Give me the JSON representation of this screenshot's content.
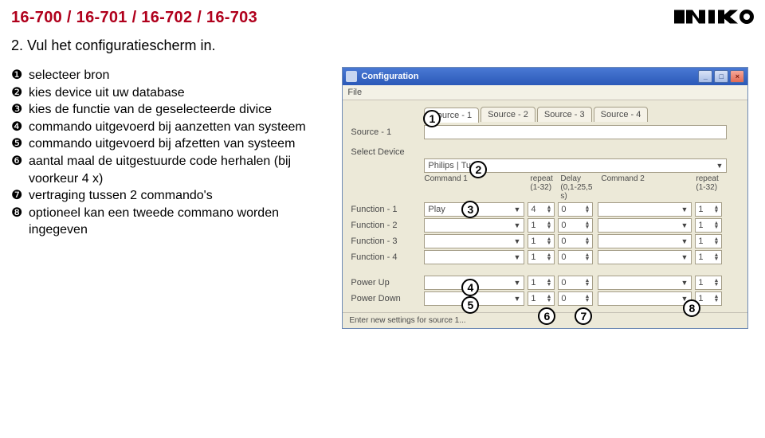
{
  "header": {
    "code": "16-700 / 16-701 / 16-702 / 16-703",
    "subtitle": "2. Vul het configuratiescherm in."
  },
  "bullets": {
    "n1": "❶",
    "t1": "selecteer bron",
    "n2": "❷",
    "t2": "kies device uit uw database",
    "n3": "❸",
    "t3": "kies de functie van de geselecteerde divice",
    "n4": "❹",
    "t4": "commando uitgevoerd bij aanzetten van systeem",
    "n5": "❺",
    "t5": "commando uitgevoerd bij afzetten van systeem",
    "n6": "❻",
    "t6": "aantal maal de uitgestuurde code herhalen (bij voorkeur 4 x)",
    "n7": "❼",
    "t7": "vertraging tussen 2 commando's",
    "n8": "❽",
    "t8": "optioneel kan een tweede commano worden ingegeven"
  },
  "win": {
    "title": "Configuration",
    "menuFile": "File",
    "sourceLabel": "Source - 1",
    "tab1": "Source - 1",
    "tab2": "Source - 2",
    "tab3": "Source - 3",
    "tab4": "Source - 4",
    "selectDevice": "Select Device",
    "deviceValue": "Philips | Tuner",
    "colCmd1": "Command 1",
    "colRep": "repeat",
    "colRepRng": "(1-32)",
    "colDelay": "Delay",
    "colDelayRng": "(0,1-25,5 s)",
    "colCmd2": "Command 2",
    "f1l": "Function - 1",
    "f1c": "Play",
    "f2l": "Function - 2",
    "f3l": "Function - 3",
    "f4l": "Function - 4",
    "pul": "Power Up",
    "pdl": "Power Down",
    "rep4": "4",
    "rep1": "1",
    "del0": "0",
    "status": "Enter new settings for source 1..."
  },
  "markers": {
    "m1": "1",
    "m2": "2",
    "m3": "3",
    "m4": "4",
    "m5": "5",
    "m6": "6",
    "m7": "7",
    "m8": "8"
  }
}
